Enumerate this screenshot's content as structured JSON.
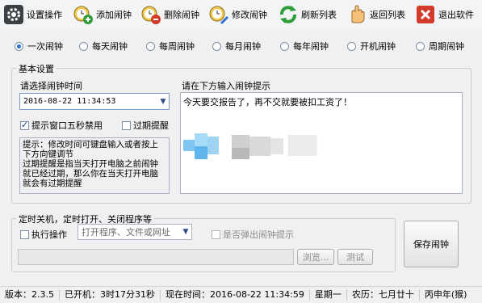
{
  "toolbar": {
    "items": [
      {
        "label": "设置操作",
        "icon": "gear-icon"
      },
      {
        "label": "添加闹钟",
        "icon": "alarm-add-icon"
      },
      {
        "label": "删除闹钟",
        "icon": "alarm-delete-icon"
      },
      {
        "label": "修改闹钟",
        "icon": "alarm-edit-icon"
      },
      {
        "label": "刷新列表",
        "icon": "refresh-icon"
      },
      {
        "label": "返回列表",
        "icon": "back-hand-icon"
      },
      {
        "label": "退出软件",
        "icon": "exit-icon"
      }
    ]
  },
  "repeat_modes": {
    "selected": "一次闹钟",
    "options": [
      "一次闹钟",
      "每天闹钟",
      "每周闹钟",
      "每月闹钟",
      "每年闹钟",
      "开机闹钟",
      "周期闹钟"
    ]
  },
  "basic": {
    "title": "基本设置",
    "time_label": "请选择闹钟时间",
    "time_value": "2016-08-22 11:34:53",
    "tip_label": "请在下方输入闹钟提示",
    "tip_text": "今天要交报告了，再不交就要被扣工资了！",
    "checkbox_block": {
      "label": "提示窗口五秒禁用",
      "checked": true
    },
    "checkbox_expire": {
      "label": "过期提醒",
      "checked": false
    },
    "hint_text": "提示：修改时间可键盘输入或者按上下方向键调节\n过期提醒是指当天打开电脑之前闹钟就已经过期，那么你在当天打开电脑就会有过期提醒"
  },
  "program": {
    "title": "定时关机，定时打开、关闭程序等",
    "execute_label": "执行操作",
    "execute_checked": false,
    "action_value": "打开程序、文件或网址",
    "popup_label": "是否弹出闹钟提示",
    "popup_checked": false,
    "path_value": "",
    "browse_label": "浏览...",
    "test_label": "测试"
  },
  "save_label": "保存闹钟",
  "status": {
    "version": "版本：2.3.5",
    "uptime": "已开机：3时17分31秒",
    "now": "现在时间：2016-08-22 11:34:59",
    "weekday": "星期一",
    "lunar": "农历：七月廿十",
    "year": "丙申年(猴)"
  },
  "colors": {
    "accent": "#2a6fd4",
    "exit_red": "#d23a2a",
    "refresh_green": "#2f9e3a"
  }
}
